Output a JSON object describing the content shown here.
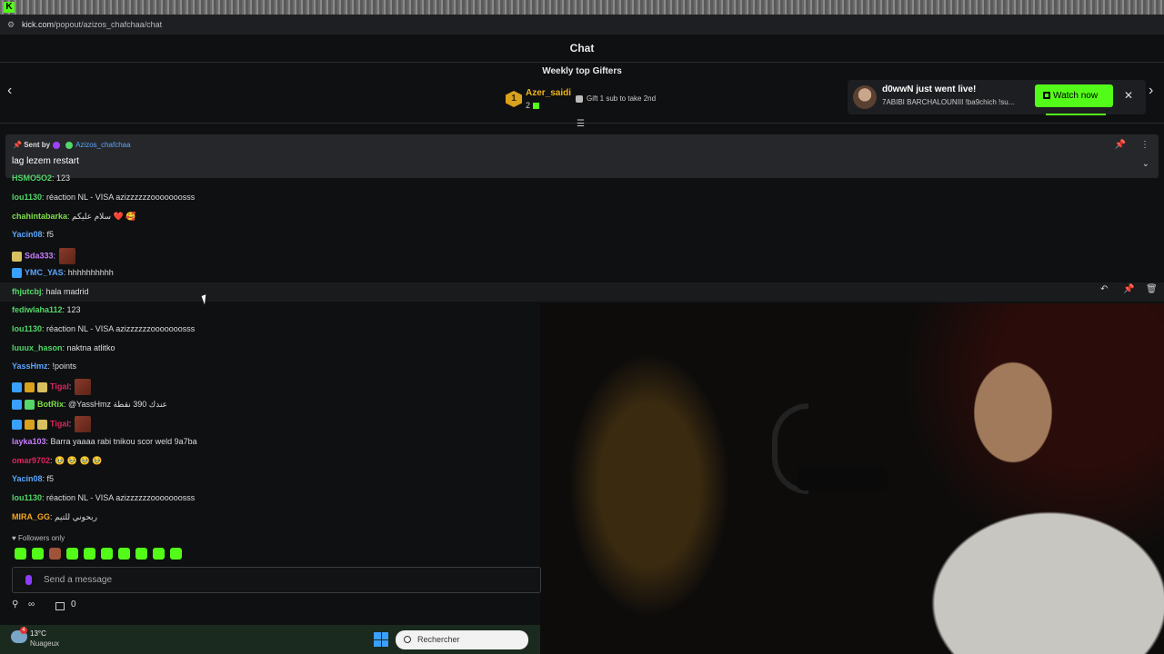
{
  "browser": {
    "url_host": "kick.com",
    "url_path": "/popout/azizos_chafchaa/chat"
  },
  "header": {
    "title": "Chat"
  },
  "gifters": {
    "title": "Weekly top Gifters",
    "top_rank": "1",
    "top_name": "Azer_saidi",
    "top_count": "2",
    "gift_note": "Gift 1 sub to take 2nd"
  },
  "notification": {
    "title": "d0wwN just went live!",
    "subtitle": "7ABIBI BARCHALOUNIII !ba9chich !su...",
    "button": "Watch now"
  },
  "pinned": {
    "sent_by_label": "Sent by",
    "username": "Azizos_chafchaa",
    "message": "lag lezem restart"
  },
  "messages": [
    {
      "user": "HSMO5O2",
      "color": "#53d769",
      "text": ": 123"
    },
    {
      "user": "lou1130",
      "color": "#53d769",
      "text": ": réaction NL - VISA azizzzzzzooooooosss"
    },
    {
      "user": "chahintabarka",
      "color": "#7de04a",
      "text": ": سلام عليكم ❤️ 🥰"
    },
    {
      "user": "Yacin08",
      "color": "#5aa6ff",
      "text": ": f5"
    },
    {
      "user": "Sda333",
      "color": "#c77dff",
      "text": ":"
    },
    {
      "user": "YMC_YAS",
      "color": "#5aa6ff",
      "text": ": hhhhhhhhhh"
    },
    {
      "user": "fhjutcbj",
      "color": "#53d769",
      "text": ": hala madrid"
    },
    {
      "user": "fediwlaha112",
      "color": "#53d769",
      "text": ": 123"
    },
    {
      "user": "lou1130",
      "color": "#53d769",
      "text": ": réaction NL - VISA azizzzzzzooooooosss"
    },
    {
      "user": "luuux_hason",
      "color": "#53d769",
      "text": ": naktna atlitko"
    },
    {
      "user": "YassHmz",
      "color": "#5aa6ff",
      "text": ": !points"
    },
    {
      "user": "Tigal",
      "color": "#e0245e",
      "text": ":"
    },
    {
      "user": "BotRix",
      "color": "#7de04a",
      "text": ": @YassHmz عندك 390 نقطة"
    },
    {
      "user": "Tigal",
      "color": "#e0245e",
      "text": ":"
    },
    {
      "user": "layka103",
      "color": "#c77dff",
      "text": ": Barra yaaaa rabi tnikou scor weld 9a7ba"
    },
    {
      "user": "omar9702",
      "color": "#e0245e",
      "text": ": 🥹 🥹 🥹 🥹"
    },
    {
      "user": "Yacin08",
      "color": "#5aa6ff",
      "text": ": f5"
    },
    {
      "user": "lou1130",
      "color": "#53d769",
      "text": ": réaction NL - VISA azizzzzzzooooooosss"
    },
    {
      "user": "MIRA_GG",
      "color": "#f5a623",
      "text": ": ربحوني للتيم"
    }
  ],
  "footer": {
    "followers_only": "Followers only",
    "input_placeholder": "Send a message",
    "infinity": "∞",
    "count": "0"
  },
  "taskbar": {
    "temperature": "13°C",
    "condition": "Nuageux",
    "notif_count": "4",
    "search_placeholder": "Rechercher"
  }
}
